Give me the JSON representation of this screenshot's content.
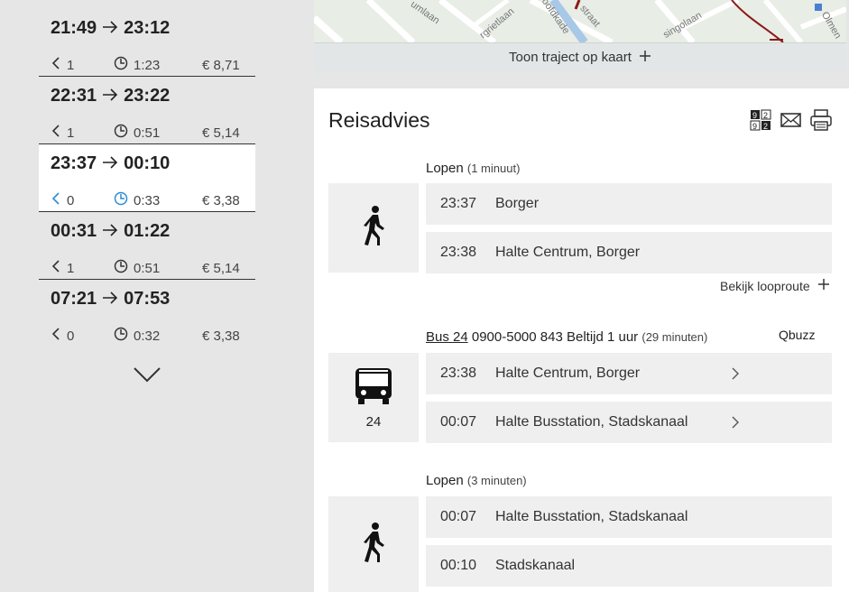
{
  "trips": [
    {
      "depart": "21:49",
      "arrive": "23:12",
      "transfers": "1",
      "duration": "1:23",
      "price": "€ 8,71",
      "selected": false
    },
    {
      "depart": "22:31",
      "arrive": "23:22",
      "transfers": "1",
      "duration": "0:51",
      "price": "€ 5,14",
      "selected": false
    },
    {
      "depart": "23:37",
      "arrive": "00:10",
      "transfers": "0",
      "duration": "0:33",
      "price": "€ 3,38",
      "selected": true
    },
    {
      "depart": "00:31",
      "arrive": "01:22",
      "transfers": "1",
      "duration": "0:51",
      "price": "€ 5,14",
      "selected": false
    },
    {
      "depart": "07:21",
      "arrive": "07:53",
      "transfers": "0",
      "duration": "0:32",
      "price": "€ 3,38",
      "selected": false
    }
  ],
  "map": {
    "street_labels": [
      "umlaan",
      "rgrietlaan",
      "oofdkade",
      "straat",
      "singolaan",
      "Olmen"
    ],
    "toggle_label": "Toon traject op kaart"
  },
  "advice": {
    "title": "Reisadvies",
    "tools": [
      "calculator-icon",
      "mail-icon",
      "print-icon"
    ],
    "legs": [
      {
        "mode": "Lopen",
        "duration": "(1 minuut)",
        "icon": "walk-icon",
        "stops": [
          {
            "time": "23:37",
            "name": "Borger"
          },
          {
            "time": "23:38",
            "name": "Halte Centrum, Borger"
          }
        ],
        "link": "Bekijk looproute"
      },
      {
        "mode": "Bus 24",
        "info": "0900-5000 843 Beltijd 1 uur",
        "duration": "(29 minuten)",
        "operator": "Qbuzz",
        "icon": "bus-icon",
        "line": "24",
        "stops": [
          {
            "time": "23:38",
            "name": "Halte Centrum, Borger"
          },
          {
            "time": "00:07",
            "name": "Halte Busstation, Stadskanaal"
          }
        ]
      },
      {
        "mode": "Lopen",
        "duration": "(3 minuten)",
        "icon": "walk-icon",
        "stops": [
          {
            "time": "00:07",
            "name": "Halte Busstation, Stadskanaal"
          },
          {
            "time": "00:10",
            "name": "Stadskanaal"
          }
        ]
      }
    ]
  },
  "colors": {
    "accent": "#2a8bd3",
    "map_route": "#8b1a1a",
    "panel_bg": "#ffffff",
    "page_bg": "#e6e6e6"
  }
}
